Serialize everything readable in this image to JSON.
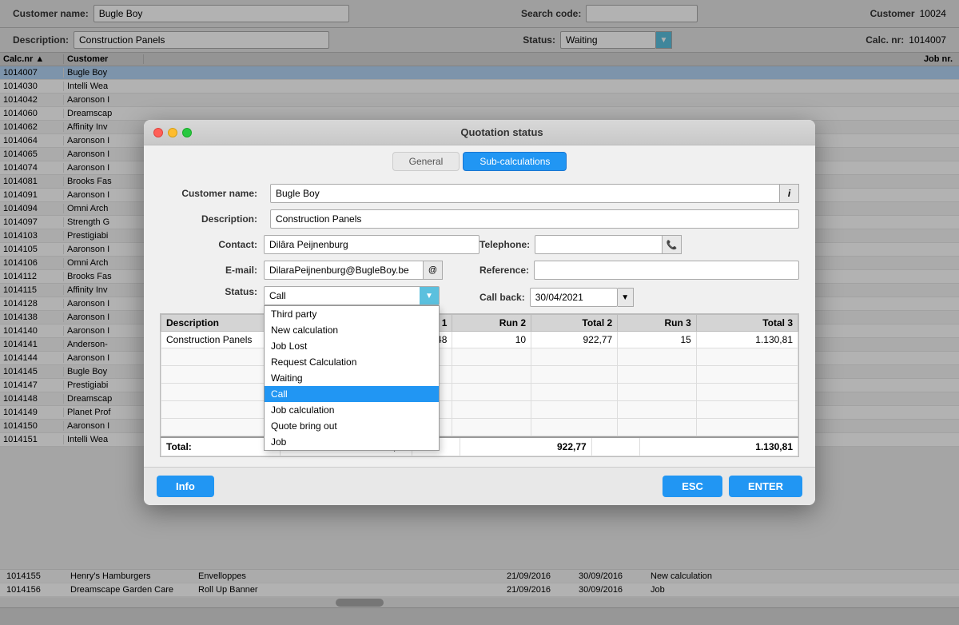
{
  "app": {
    "customer_name_label": "Customer name:",
    "customer_name_value": "Bugle Boy",
    "description_label": "Description:",
    "description_value": "Construction Panels",
    "search_code_label": "Search code:",
    "search_code_value": "",
    "status_label": "Status:",
    "status_value": "Waiting",
    "customer_label": "Customer",
    "customer_value": "10024",
    "calc_nr_label": "Calc. nr:",
    "calc_nr_value": "1014007"
  },
  "background_table": {
    "col_calc_nr": "Calc.nr",
    "col_customer": "Customer",
    "col_job_nr": "Job nr.",
    "rows": [
      {
        "calc_nr": "1014007",
        "customer": "Bugle Boy",
        "job_nr": "",
        "selected": true
      },
      {
        "calc_nr": "1014030",
        "customer": "Intelli Wea",
        "job_nr": "",
        "selected": false,
        "alt": false
      },
      {
        "calc_nr": "1014042",
        "customer": "Aaronson I",
        "job_nr": "",
        "selected": false,
        "alt": true
      },
      {
        "calc_nr": "1014060",
        "customer": "Dreamscap",
        "job_nr": "",
        "selected": false,
        "alt": false
      },
      {
        "calc_nr": "1014062",
        "customer": "Affinity Inv",
        "job_nr": "",
        "selected": false,
        "alt": true
      },
      {
        "calc_nr": "1014064",
        "customer": "Aaronson I",
        "job_nr": "",
        "selected": false,
        "alt": false
      },
      {
        "calc_nr": "1014065",
        "customer": "Aaronson I",
        "job_nr": "",
        "selected": false,
        "alt": true
      },
      {
        "calc_nr": "1014074",
        "customer": "Aaronson I",
        "job_nr": "",
        "selected": false,
        "alt": false
      },
      {
        "calc_nr": "1014081",
        "customer": "Brooks Fas",
        "job_nr": "",
        "selected": false,
        "alt": true
      },
      {
        "calc_nr": "1014091",
        "customer": "Aaronson I",
        "job_nr": "",
        "selected": false,
        "alt": false
      },
      {
        "calc_nr": "1014094",
        "customer": "Omni Arch",
        "job_nr": "",
        "selected": false,
        "alt": true
      },
      {
        "calc_nr": "1014097",
        "customer": "Strength G",
        "job_nr": "",
        "selected": false,
        "alt": false
      },
      {
        "calc_nr": "1014103",
        "customer": "Prestigiabi",
        "job_nr": "",
        "selected": false,
        "alt": true
      },
      {
        "calc_nr": "1014105",
        "customer": "Aaronson I",
        "job_nr": "",
        "selected": false,
        "alt": false
      },
      {
        "calc_nr": "1014106",
        "customer": "Omni Arch",
        "job_nr": "",
        "selected": false,
        "alt": true
      },
      {
        "calc_nr": "1014112",
        "customer": "Brooks Fas",
        "job_nr": "",
        "selected": false,
        "alt": false
      },
      {
        "calc_nr": "1014115",
        "customer": "Affinity Inv",
        "job_nr": "",
        "selected": false,
        "alt": true
      },
      {
        "calc_nr": "1014128",
        "customer": "Aaronson I",
        "job_nr": "",
        "selected": false,
        "alt": false
      },
      {
        "calc_nr": "1014138",
        "customer": "Aaronson I",
        "job_nr": "",
        "selected": false,
        "alt": true
      },
      {
        "calc_nr": "1014140",
        "customer": "Aaronson I",
        "job_nr": "",
        "selected": false,
        "alt": false
      },
      {
        "calc_nr": "1014141",
        "customer": "Anderson-",
        "job_nr": "",
        "selected": false,
        "alt": true
      },
      {
        "calc_nr": "1014144",
        "customer": "Aaronson I",
        "job_nr": "",
        "selected": false,
        "alt": false
      },
      {
        "calc_nr": "1014145",
        "customer": "Bugle Boy",
        "job_nr": "",
        "selected": false,
        "alt": true
      },
      {
        "calc_nr": "1014147",
        "customer": "Prestigiabi",
        "job_nr": "",
        "selected": false,
        "alt": false
      },
      {
        "calc_nr": "1014148",
        "customer": "Dreamscap",
        "job_nr": "",
        "selected": false,
        "alt": true
      },
      {
        "calc_nr": "1014149",
        "customer": "Planet Prof",
        "job_nr": "",
        "selected": false,
        "alt": false
      },
      {
        "calc_nr": "1014150",
        "customer": "Aaronson I",
        "job_nr": "",
        "selected": false,
        "alt": true
      },
      {
        "calc_nr": "1014151",
        "customer": "Intelli Wea",
        "job_nr": "",
        "selected": false,
        "alt": false
      },
      {
        "calc_nr": "1014155",
        "customer": "Henry's Hamburgers",
        "desc": "Envelloppes",
        "date1": "21/09/2016",
        "date2": "30/09/2016",
        "status": "New calculation",
        "alt": true
      },
      {
        "calc_nr": "1014156",
        "customer": "Dreamscape Garden Care",
        "desc": "Roll Up Banner",
        "date1": "21/09/2016",
        "date2": "30/09/2016",
        "status": "Job",
        "alt": false
      }
    ]
  },
  "modal": {
    "title": "Quotation status",
    "tab_general": "General",
    "tab_subcalculations": "Sub-calculations",
    "active_tab": "Sub-calculations",
    "customer_name_label": "Customer name:",
    "customer_name_value": "Bugle Boy",
    "description_label": "Description:",
    "description_value": "Construction Panels",
    "contact_label": "Contact:",
    "contact_value": "Dilâra Peijnenburg",
    "telephone_label": "Telephone:",
    "telephone_value": "",
    "email_label": "E-mail:",
    "email_value": "DilaraPeijnenburg@BugleBoy.be",
    "reference_label": "Reference:",
    "reference_value": "",
    "status_label": "Status:",
    "status_value": "Call",
    "callbacklabel": "Call back:",
    "callback_value": "30/04/2021",
    "dropdown_options": [
      {
        "label": "Third party",
        "value": "Third party",
        "selected": false
      },
      {
        "label": "New calculation",
        "value": "New calculation",
        "selected": false
      },
      {
        "label": "Job Lost",
        "value": "Job Lost",
        "selected": false
      },
      {
        "label": "Request Calculation",
        "value": "Request Calculation",
        "selected": false
      },
      {
        "label": "Waiting",
        "value": "Waiting",
        "selected": false
      },
      {
        "label": "Call",
        "value": "Call",
        "selected": true
      },
      {
        "label": "Job calculation",
        "value": "Job calculation",
        "selected": false
      },
      {
        "label": "Quote bring out",
        "value": "Quote bring out",
        "selected": false
      },
      {
        "label": "Job",
        "value": "Job",
        "selected": false
      }
    ],
    "sub_table": {
      "col_description": "Description",
      "col_total1": "Total 1",
      "col_run2": "Run 2",
      "col_total2": "Total 2",
      "col_run3": "Run 3",
      "col_total3": "Total 3",
      "rows": [
        {
          "description": "Construction Panels",
          "total1": "581,48",
          "run2": "10",
          "total2": "922,77",
          "run3": "15",
          "total3": "1.130,81"
        }
      ],
      "total_label": "Total:",
      "total_total1": "581,48",
      "total_total2": "922,77",
      "total_total3": "1.130,81"
    },
    "btn_info": "Info",
    "btn_esc": "ESC",
    "btn_enter": "ENTER"
  }
}
